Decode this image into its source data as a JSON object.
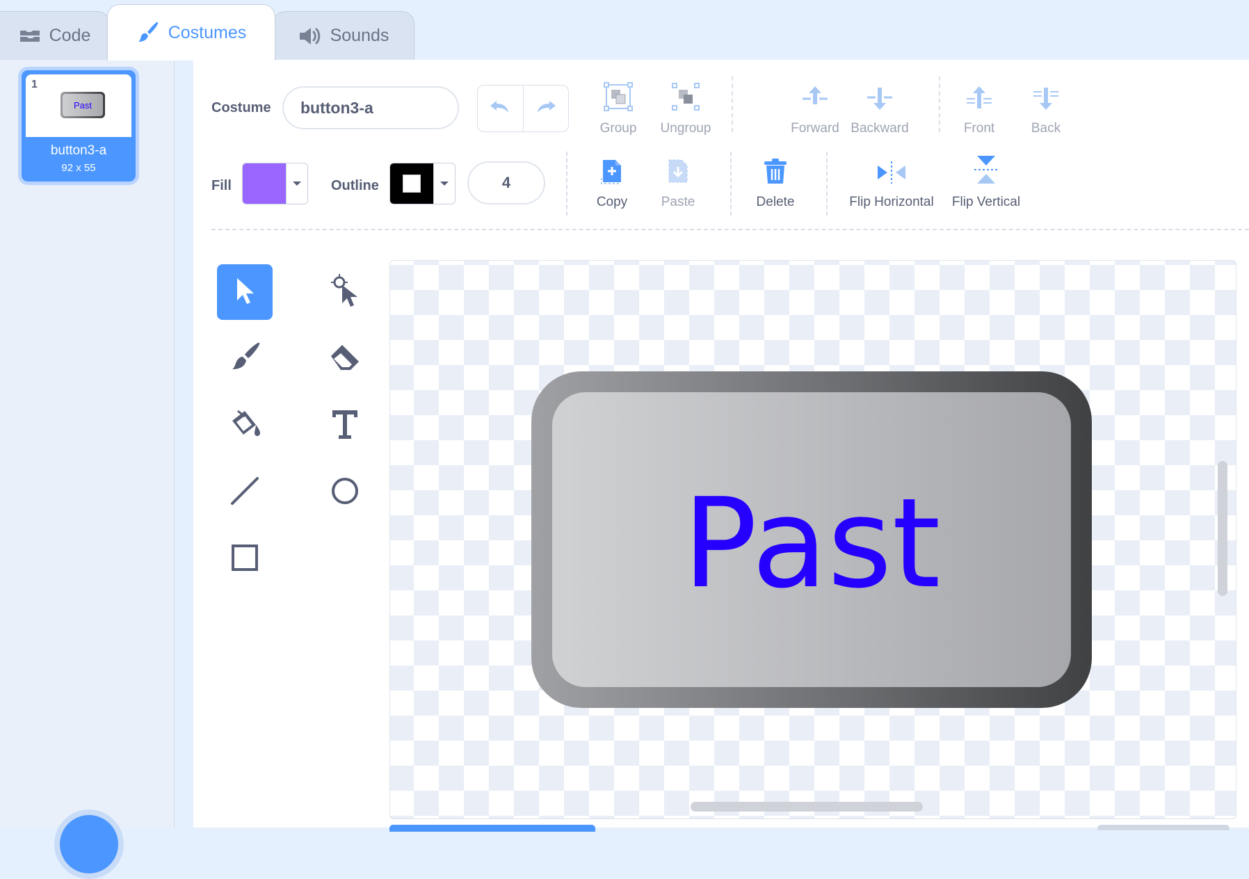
{
  "tabs": [
    {
      "label": "Code",
      "icon": "code-blocks-icon",
      "active": false
    },
    {
      "label": "Costumes",
      "icon": "paintbrush-icon",
      "active": true
    },
    {
      "label": "Sounds",
      "icon": "speaker-icon",
      "active": false
    }
  ],
  "costume_list": [
    {
      "number": "1",
      "name": "button3-a",
      "size": "92 x 55",
      "thumb_text": "Past",
      "selected": true
    }
  ],
  "editor": {
    "costume_label": "Costume",
    "costume_name": "button3-a",
    "fill_label": "Fill",
    "fill_color": "#9966ff",
    "outline_label": "Outline",
    "outline_color": "#000000",
    "outline_width": "4",
    "toolbar_row1": [
      {
        "label": "Group",
        "icon": "group-icon",
        "enabled": false
      },
      {
        "label": "Ungroup",
        "icon": "ungroup-icon",
        "enabled": false
      },
      {
        "label": "Forward",
        "icon": "forward-icon",
        "enabled": false
      },
      {
        "label": "Backward",
        "icon": "backward-icon",
        "enabled": false
      },
      {
        "label": "Front",
        "icon": "front-icon",
        "enabled": false
      },
      {
        "label": "Back",
        "icon": "back-icon",
        "enabled": false
      }
    ],
    "toolbar_row2": [
      {
        "label": "Copy",
        "icon": "copy-icon",
        "enabled": true
      },
      {
        "label": "Paste",
        "icon": "paste-icon",
        "enabled": false
      },
      {
        "label": "Delete",
        "icon": "trash-icon",
        "enabled": true
      },
      {
        "label": "Flip Horizontal",
        "icon": "flip-horizontal-icon",
        "enabled": true
      },
      {
        "label": "Flip Vertical",
        "icon": "flip-vertical-icon",
        "enabled": true
      }
    ],
    "tools": [
      {
        "name": "select",
        "icon": "arrow-cursor-icon",
        "active": true
      },
      {
        "name": "reshape",
        "icon": "reshape-icon",
        "active": false
      },
      {
        "name": "brush",
        "icon": "brush-icon",
        "active": false
      },
      {
        "name": "eraser",
        "icon": "eraser-icon",
        "active": false
      },
      {
        "name": "fill",
        "icon": "paint-bucket-icon",
        "active": false
      },
      {
        "name": "text",
        "icon": "text-icon",
        "active": false
      },
      {
        "name": "line",
        "icon": "line-icon",
        "active": false
      },
      {
        "name": "circle",
        "icon": "circle-icon",
        "active": false
      },
      {
        "name": "rectangle",
        "icon": "rectangle-icon",
        "active": false
      }
    ],
    "canvas": {
      "costume_text": "Past",
      "text_color": "#2500ff"
    }
  },
  "colors": {
    "accent": "#4c97ff",
    "tab_bg": "#e5f0ff",
    "disabled": "#9ea4b3"
  }
}
